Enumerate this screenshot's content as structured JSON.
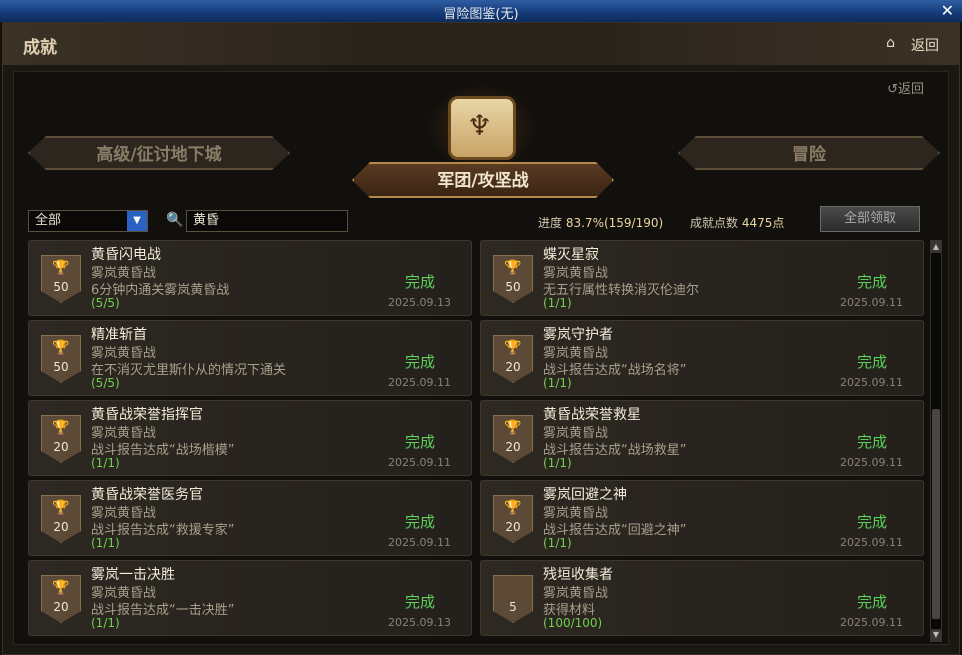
{
  "window": {
    "title": "冒险图鉴(无)",
    "close": "✕"
  },
  "header": {
    "title": "成就",
    "home_icon": "home-icon",
    "back": "返回"
  },
  "panel": {
    "back": "↺返回"
  },
  "tabs": [
    {
      "label": "高级/征讨地下城",
      "active": false
    },
    {
      "label": "军团/攻坚战",
      "active": true
    },
    {
      "label": "冒险",
      "active": false
    }
  ],
  "filter": {
    "selected": "全部",
    "search_value": "黄昏"
  },
  "stats": {
    "progress_label": "进度",
    "progress_value": "83.7%(159/190)",
    "points_label": "成就点数",
    "points_value": "4475点"
  },
  "claim_all": "全部领取",
  "achievements": [
    {
      "title": "黄昏闪电战",
      "category": "雾岚黄昏战",
      "desc": "6分钟内通关雾岚黄昏战",
      "count": "(5/5)",
      "points": "50",
      "tier": "gold",
      "status": "完成",
      "date": "2025.09.13"
    },
    {
      "title": "蝶灭星寂",
      "category": "雾岚黄昏战",
      "desc": "无五行属性转换消灭伦迪尔",
      "count": "(1/1)",
      "points": "50",
      "tier": "gold",
      "status": "完成",
      "date": "2025.09.11"
    },
    {
      "title": "精准斩首",
      "category": "雾岚黄昏战",
      "desc": "在不消灭尤里斯仆从的情况下通关",
      "count": "(5/5)",
      "points": "50",
      "tier": "gold",
      "status": "完成",
      "date": "2025.09.11"
    },
    {
      "title": "雾岚守护者",
      "category": "雾岚黄昏战",
      "desc": "战斗报告达成“战场名将”",
      "count": "(1/1)",
      "points": "20",
      "tier": "silver",
      "status": "完成",
      "date": "2025.09.11"
    },
    {
      "title": "黄昏战荣誉指挥官",
      "category": "雾岚黄昏战",
      "desc": "战斗报告达成“战场楷模”",
      "count": "(1/1)",
      "points": "20",
      "tier": "silver",
      "status": "完成",
      "date": "2025.09.11"
    },
    {
      "title": "黄昏战荣誉救星",
      "category": "雾岚黄昏战",
      "desc": "战斗报告达成“战场救星”",
      "count": "(1/1)",
      "points": "20",
      "tier": "silver",
      "status": "完成",
      "date": "2025.09.11"
    },
    {
      "title": "黄昏战荣誉医务官",
      "category": "雾岚黄昏战",
      "desc": "战斗报告达成“救援专家”",
      "count": "(1/1)",
      "points": "20",
      "tier": "silver",
      "status": "完成",
      "date": "2025.09.11"
    },
    {
      "title": "雾岚回避之神",
      "category": "雾岚黄昏战",
      "desc": "战斗报告达成“回避之神”",
      "count": "(1/1)",
      "points": "20",
      "tier": "silver",
      "status": "完成",
      "date": "2025.09.11"
    },
    {
      "title": "雾岚一击决胜",
      "category": "雾岚黄昏战",
      "desc": "战斗报告达成“一击决胜”",
      "count": "(1/1)",
      "points": "20",
      "tier": "silver",
      "status": "完成",
      "date": "2025.09.13"
    },
    {
      "title": "残垣收集者",
      "category": "雾岚黄昏战",
      "desc": "获得材料",
      "count": "(100/100)",
      "points": "5",
      "tier": "bronze",
      "status": "完成",
      "date": "2025.09.11"
    }
  ]
}
